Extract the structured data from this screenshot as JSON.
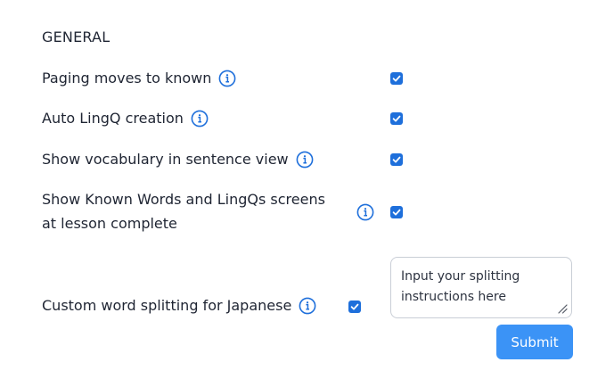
{
  "section": {
    "title": "GENERAL"
  },
  "settings": [
    {
      "label": "Paging moves to known",
      "checked": true
    },
    {
      "label": "Auto LingQ creation",
      "checked": true
    },
    {
      "label": "Show vocabulary in sentence view",
      "checked": true
    },
    {
      "label_line1": "Show Known Words and LingQs screens",
      "label_line2": "at lesson complete",
      "checked": true
    },
    {
      "label": "Custom word splitting for Japanese",
      "checked": true
    }
  ],
  "splitting_input": {
    "placeholder": "Input your splitting instructions here",
    "value": ""
  },
  "submit": {
    "label": "Submit"
  },
  "colors": {
    "accent": "#1e6fdb",
    "button": "#3b93f6",
    "text": "#1f2533"
  },
  "icons": {
    "info": "info-circle-icon",
    "check": "checkmark-icon",
    "resize": "resize-grip-icon"
  }
}
